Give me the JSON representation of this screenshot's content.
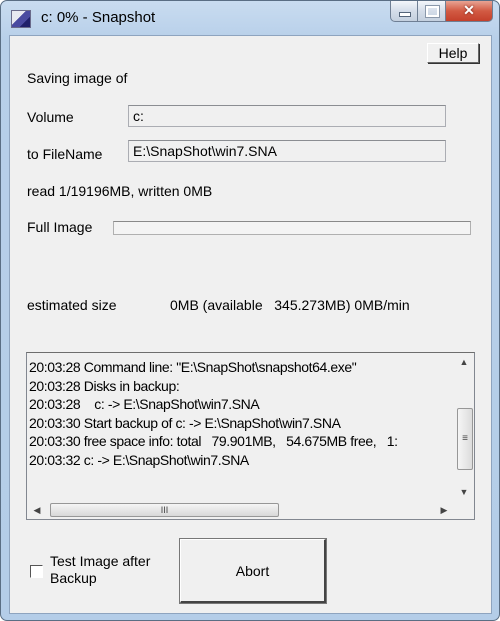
{
  "window": {
    "title": "c: 0% - Snapshot",
    "icon": "snapshot-app-icon",
    "controls": {
      "minimize": "minimize-icon",
      "maximize": "maximize-icon",
      "close": "✕"
    }
  },
  "help_label": "Help",
  "heading": "Saving image of",
  "volume": {
    "label": "Volume",
    "value": "c:"
  },
  "filename": {
    "label": "to FileName",
    "value": "E:\\SnapShot\\win7.SNA"
  },
  "progress_text": "read 1/19196MB, written 0MB",
  "full_image": {
    "label": "Full Image",
    "progress_percent": 0
  },
  "estimated": {
    "label": "estimated size",
    "value": "0MB (available   345.273MB) 0MB/min"
  },
  "log": {
    "lines": [
      "20:03:28 Command line: \"E:\\SnapShot\\snapshot64.exe\"",
      "20:03:28 Disks in backup:",
      "20:03:28    c: -> E:\\SnapShot\\win7.SNA",
      "20:03:30 Start backup of c: -> E:\\SnapShot\\win7.SNA",
      "20:03:30 free space info: total   79.901MB,   54.675MB free,   1:",
      "20:03:32 c: -> E:\\SnapShot\\win7.SNA"
    ],
    "scroll_up": "▲",
    "scroll_down": "▼",
    "scroll_left": "◀",
    "scroll_right": "▶",
    "v_grip": "≡",
    "h_grip": "III"
  },
  "test_checkbox": {
    "label_line1": "Test Image after",
    "label_line2": "Backup",
    "checked": false
  },
  "abort_label": "Abort"
}
